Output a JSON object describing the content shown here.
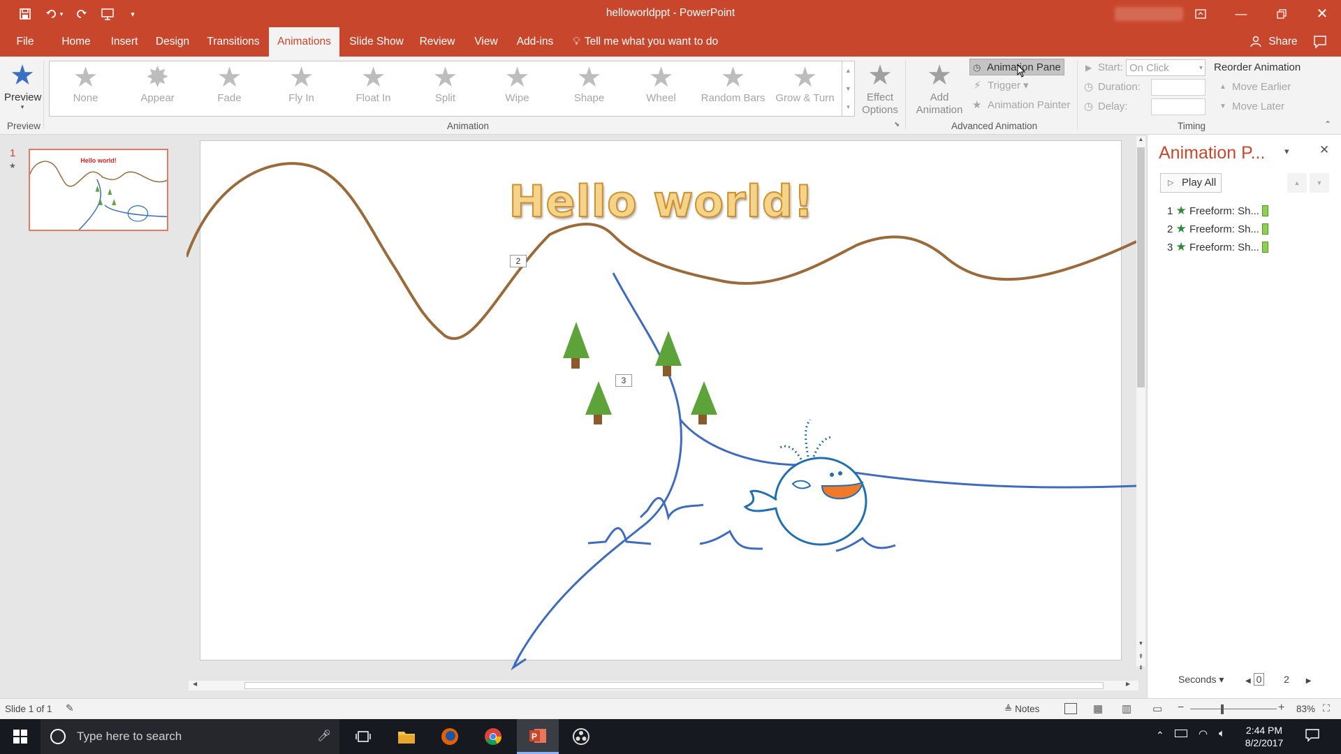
{
  "window": {
    "title": "helloworldppt - PowerPoint",
    "user": "Ryan Keisling"
  },
  "tabs": [
    {
      "label": "File"
    },
    {
      "label": "Home"
    },
    {
      "label": "Insert"
    },
    {
      "label": "Design"
    },
    {
      "label": "Transitions"
    },
    {
      "label": "Animations"
    },
    {
      "label": "Slide Show"
    },
    {
      "label": "Review"
    },
    {
      "label": "View"
    },
    {
      "label": "Add-ins"
    }
  ],
  "active_tab": "Animations",
  "tell_me": "Tell me what you want to do",
  "share": "Share",
  "ribbon": {
    "preview": "Preview",
    "preview_group": "Preview",
    "animations": [
      "None",
      "Appear",
      "Fade",
      "Fly In",
      "Float In",
      "Split",
      "Wipe",
      "Shape",
      "Wheel",
      "Random Bars",
      "Grow & Turn"
    ],
    "effect_options": [
      "Effect",
      "Options"
    ],
    "animation_group": "Animation",
    "add_animation": [
      "Add",
      "Animation"
    ],
    "animation_pane": "Animation Pane",
    "trigger": "Trigger",
    "animation_painter": "Animation Painter",
    "advanced_group": "Advanced Animation",
    "start_label": "Start:",
    "start_value": "On Click",
    "duration_label": "Duration:",
    "delay_label": "Delay:",
    "reorder_title": "Reorder Animation",
    "move_earlier": "Move Earlier",
    "move_later": "Move Later",
    "timing_group": "Timing"
  },
  "thumbnail": {
    "number": "1",
    "title": "Hello world!"
  },
  "slide": {
    "title": "Hello world!",
    "tag2": "2",
    "tag3": "3"
  },
  "anim_pane": {
    "title": "Animation P...",
    "play_all": "Play All",
    "items": [
      {
        "num": "1",
        "label": "Freeform: Sh..."
      },
      {
        "num": "2",
        "label": "Freeform: Sh..."
      },
      {
        "num": "3",
        "label": "Freeform: Sh..."
      }
    ],
    "seconds": "Seconds",
    "timeline_start": "0",
    "timeline_end": "2"
  },
  "status": {
    "slide": "Slide 1 of 1",
    "notes": "Notes",
    "zoom": "83%"
  },
  "taskbar": {
    "search": "Type here to search",
    "time": "2:44 PM",
    "date": "8/2/2017"
  },
  "colors": {
    "accent": "#c8472c",
    "tree": "#5ea33a",
    "trunk": "#8a5a2b",
    "mountain": "#9a6a3a",
    "river": "#3d6bbf",
    "whale": "#1f6fb2"
  }
}
